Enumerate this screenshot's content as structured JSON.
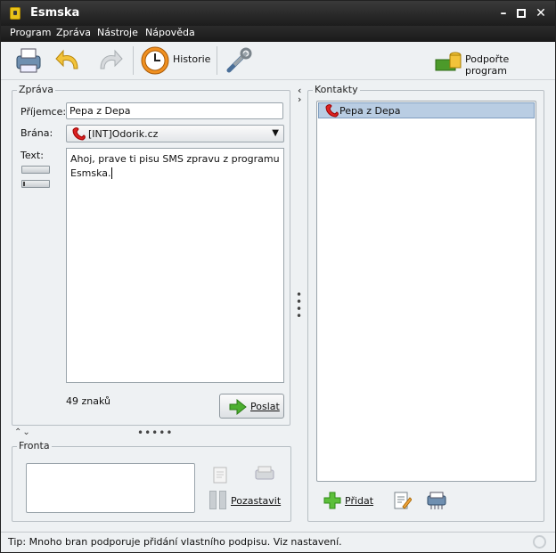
{
  "window": {
    "title": "Esmska"
  },
  "menu": [
    "Program",
    "Zpráva",
    "Nástroje",
    "Nápověda"
  ],
  "toolbar": {
    "history_label": "Historie",
    "support_label": "Podpořte program"
  },
  "message": {
    "legend": "Zpráva",
    "recipient_label": "Příjemce:",
    "recipient_value": "Pepa z Depa",
    "gateway_label": "Brána:",
    "gateway_value": "[INT]Odorik.cz",
    "text_label": "Text:",
    "text_line1": "Ahoj, prave ti pisu SMS zpravu z programu",
    "text_line2": "Esmska.",
    "char_count": "49 znaků",
    "send_label": "Poslat"
  },
  "queue": {
    "legend": "Fronta",
    "pause_label": "Pozastavit"
  },
  "contacts": {
    "legend": "Kontakty",
    "items": [
      "Pepa z Depa"
    ],
    "add_label": "Přidat"
  },
  "status": {
    "tip": "Tip: Mnoho bran podporuje přidání vlastního podpisu. Viz nastavení."
  }
}
